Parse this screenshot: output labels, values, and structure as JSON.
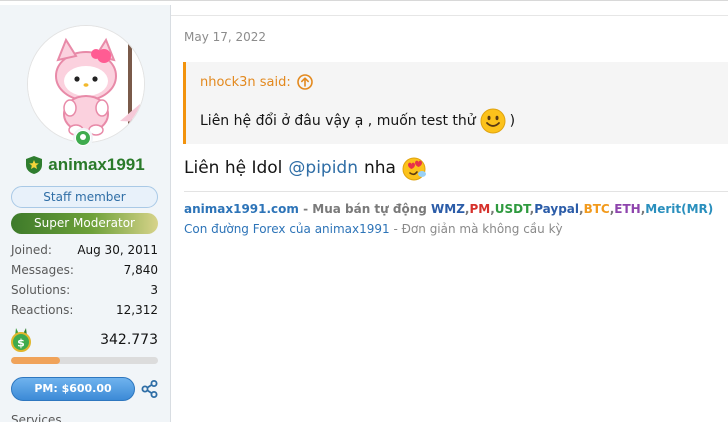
{
  "user": {
    "username": "animax1991",
    "staff_badge": "Staff member",
    "role_badge": "Super Moderator",
    "stats": [
      {
        "label": "Joined:",
        "value": "Aug 30, 2011"
      },
      {
        "label": "Messages:",
        "value": "7,840"
      },
      {
        "label": "Solutions:",
        "value": "3"
      },
      {
        "label": "Reactions:",
        "value": "12,312"
      }
    ],
    "coins": "342.773",
    "coins_progress_percent": 33,
    "pm_button": "PM: $600.00",
    "services_label": "Services"
  },
  "post": {
    "date": "May 17, 2022",
    "quote": {
      "author": "nhock3n said:",
      "text": "Liên hệ đổi ở đâu vậy ạ , muốn test thử",
      "text_end": ")"
    },
    "message": {
      "prefix": "Liên hệ Idol",
      "mention": "@pipidn",
      "suffix": "nha"
    },
    "signature": {
      "site": "animax1991.com",
      "dash1": " - Mua bán tự động ",
      "items": [
        {
          "text": "WMZ",
          "color": "#2b5ca8"
        },
        {
          "text": "PM",
          "color": "#d6312b"
        },
        {
          "text": "USDT",
          "color": "#2e9a3e"
        },
        {
          "text": "Paypal",
          "color": "#2b5ca8"
        },
        {
          "text": "BTC",
          "color": "#f29a1c"
        },
        {
          "text": "ETH",
          "color": "#8e44ad"
        },
        {
          "text": "Merit(MR)",
          "color": "#2a8fbd"
        }
      ],
      "line2_link": "Con đường Forex của animax1991",
      "line2_rest": " - Đơn giản mà không cầu kỳ"
    }
  },
  "colors": {
    "quote_accent": "#f2930d",
    "username": "#2a7a2a",
    "link": "#2d74b8"
  }
}
